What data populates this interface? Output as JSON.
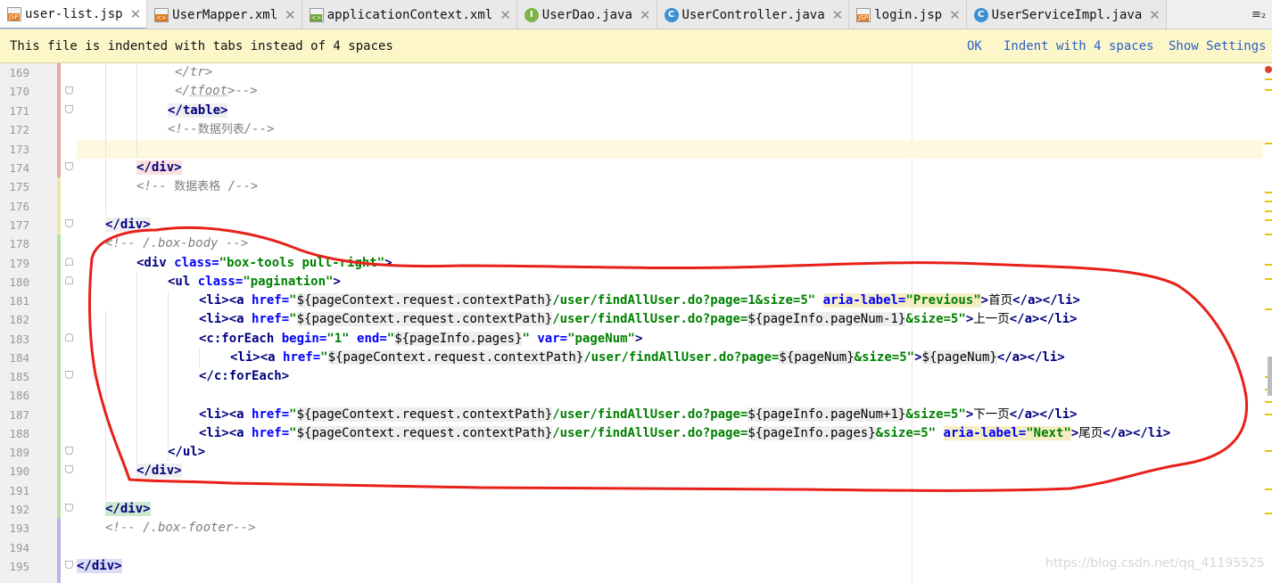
{
  "tabs": [
    {
      "label": "user-list.jsp",
      "icon": "jsp-file-icon",
      "active": true
    },
    {
      "label": "UserMapper.xml",
      "icon": "xml-file-icon"
    },
    {
      "label": "applicationContext.xml",
      "icon": "xml-file-icon"
    },
    {
      "label": "UserDao.java",
      "icon": "interface-icon"
    },
    {
      "label": "UserController.java",
      "icon": "class-icon"
    },
    {
      "label": "login.jsp",
      "icon": "jsp-file-icon"
    },
    {
      "label": "UserServiceImpl.java",
      "icon": "class-icon"
    }
  ],
  "tab_overflow": "≡₂",
  "banner": {
    "message": "This file is indented with tabs instead of 4 spaces",
    "ok": "OK",
    "indent": "Indent with 4 spaces",
    "settings": "Show Settings"
  },
  "line_numbers": [
    "169",
    "170",
    "171",
    "172",
    "173",
    "174",
    "175",
    "176",
    "177",
    "178",
    "179",
    "180",
    "181",
    "182",
    "183",
    "184",
    "185",
    "186",
    "187",
    "188",
    "189",
    "190",
    "191",
    "192",
    "193",
    "194",
    "195"
  ],
  "code": {
    "l169": "</tr>",
    "l170_a": "</",
    "l170_b": "tfoot",
    "l170_c": ">-->",
    "l171": "</table>",
    "l172_a": "<!--",
    "l172_b": "数据列表",
    "l172_c": "/-->",
    "l174": "</div>",
    "l175_a": "<!-- ",
    "l175_b": "数据表格",
    "l175_c": " /-->",
    "l177": "</div>",
    "l178": "<!-- /.box-body -->",
    "l179_tag": "<div ",
    "l179_attr": "class=",
    "l179_val": "\"box-tools pull-right\"",
    "l179_end": ">",
    "l180_tag": "<ul ",
    "l180_attr": "class=",
    "l180_val": "\"pagination\"",
    "l180_end": ">",
    "li_open": "<li><a ",
    "href_attr": "href=",
    "q": "\"",
    "ctx": "${pageContext.request.contextPath}",
    "l181_path": "/user/findAllUser.do?page=1&size=5",
    "aria_attr": "aria-label=",
    "l181_aria": "\"Previous\"",
    "close_gt": ">",
    "l181_text": "首页",
    "a_li_close": "</a></li>",
    "path_base": "/user/findAllUser.do?page=",
    "l182_expr": "${pageInfo.pageNum-1}",
    "size5": "&size=5",
    "l182_text": "上一页",
    "l183_tag": "<c:forEach ",
    "begin_attr": "begin=",
    "begin_val": "\"1\"",
    "end_attr": "end=",
    "end_val_q": "\"",
    "end_expr": "${pageInfo.pages}",
    "var_attr": "var=",
    "var_val": "\"pageNum\"",
    "l184_expr": "${pageNum}",
    "l185": "</c:forEach>",
    "l187_expr": "${pageInfo.pageNum+1}",
    "l187_text": "下一页",
    "l188_expr": "${pageInfo.pages}",
    "l188_aria": "\"Next\"",
    "l188_text": "尾页",
    "l189": "</ul>",
    "l190": "</div>",
    "l192": "</div>",
    "l193": "<!-- /.box-footer-->",
    "l195": "</div>"
  },
  "watermark": "https://blog.csdn.net/qq_41195525",
  "colors": {
    "tag": "#000080",
    "attr": "#0000ff",
    "string": "#008000",
    "comment": "#808080",
    "annotation": "#e8201a"
  }
}
